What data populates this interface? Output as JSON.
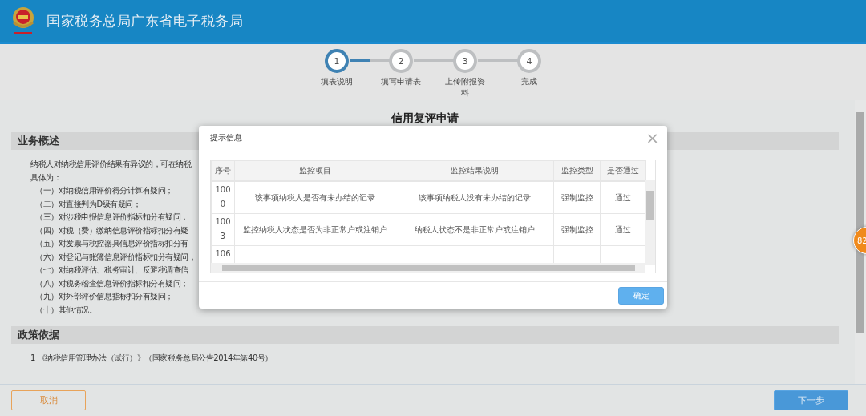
{
  "header": {
    "title": "国家税务总局广东省电子税务局"
  },
  "steps": [
    {
      "number": "1",
      "label": "填表说明",
      "current": true
    },
    {
      "number": "2",
      "label": "填写申请表",
      "current": false
    },
    {
      "number": "3",
      "label": "上传附报资料",
      "current": false
    },
    {
      "number": "4",
      "label": "完成",
      "current": false
    }
  ],
  "page": {
    "title": "信用复评申请",
    "sections": [
      {
        "heading": "业务概述",
        "lines": [
          {
            "kind": "para",
            "text": "纳税人对纳税信用评价结果有异议的，可在纳税"
          },
          {
            "kind": "para",
            "text": "具体为："
          },
          {
            "kind": "item",
            "text": "（一）对纳税信用评价得分计算有疑问；"
          },
          {
            "kind": "item",
            "text": "（二）对直接判为D级有疑问；"
          },
          {
            "kind": "item",
            "text": "（三）对涉税申报信息评价指标扣分有疑问；"
          },
          {
            "kind": "item",
            "text": "（四）对税（费）缴纳信息评价指标扣分有疑"
          },
          {
            "kind": "item",
            "text": "（五）对发票与税控器具信息评价指标扣分有"
          },
          {
            "kind": "item",
            "text": "（六）对登记与账簿信息评价指标扣分有疑问；"
          },
          {
            "kind": "item",
            "text": "（七）对纳税评估、税务审计、反避税调查信"
          },
          {
            "kind": "item",
            "text": "（八）对税务稽查信息评价指标扣分有疑问；"
          },
          {
            "kind": "item",
            "text": "（九）对外部评价信息指标扣分有疑问；"
          },
          {
            "kind": "item",
            "text": "（十）其他情况。"
          }
        ]
      },
      {
        "heading": "政策依据",
        "lines": [
          {
            "kind": "para",
            "text": "1 《纳税信用管理办法（试行）》（国家税务总局公告2014年第40号）"
          }
        ]
      }
    ]
  },
  "badge": {
    "text": "82"
  },
  "dialog": {
    "title": "提示信息",
    "close": "×",
    "table": {
      "columns": [
        "序号",
        "监控项目",
        "监控结果说明",
        "监控类型",
        "是否通过"
      ],
      "rows": [
        [
          "1000",
          "该事项纳税人是否有未办结的记录",
          "该事项纳税人没有未办结的记录",
          "强制监控",
          "通过"
        ],
        [
          "1003",
          "监控纳税人状态是否为非正常户或注销户",
          "纳税人状态不是非正常户或注销户",
          "强制监控",
          "通过"
        ],
        [
          "106"
        ]
      ]
    },
    "button": "确定"
  },
  "footer": {
    "cancel": "取消",
    "next": "下一步"
  }
}
